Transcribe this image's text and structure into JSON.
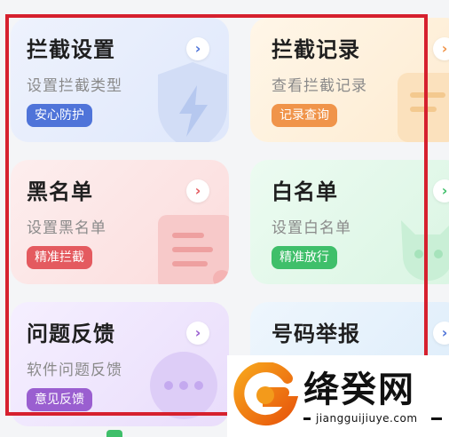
{
  "cards": [
    {
      "title": "拦截设置",
      "subtitle": "设置拦截类型",
      "badge": "安心防护"
    },
    {
      "title": "拦截记录",
      "subtitle": "查看拦截记录",
      "badge": "记录查询"
    },
    {
      "title": "黑名单",
      "subtitle": "设置黑名单",
      "badge": "精准拦截"
    },
    {
      "title": "白名单",
      "subtitle": "设置白名单",
      "badge": "精准放行"
    },
    {
      "title": "问题反馈",
      "subtitle": "软件问题反馈",
      "badge": "意见反馈"
    },
    {
      "title": "号码举报"
    }
  ],
  "colors": {
    "highlight_frame": "#d6202e",
    "badge_blue": "#4f74d9",
    "badge_orange": "#f0944a",
    "badge_red": "#e45a5f",
    "badge_green": "#3fbf6a",
    "badge_purple": "#9a5fd0"
  },
  "watermark": {
    "logo_text": "绛癸网",
    "url": "jiangguijiuye.com"
  },
  "icons": [
    "chevron-right-icon",
    "shield-bolt-icon",
    "document-icon",
    "list-icon",
    "devil-face-icon",
    "chat-bubble-icon"
  ]
}
